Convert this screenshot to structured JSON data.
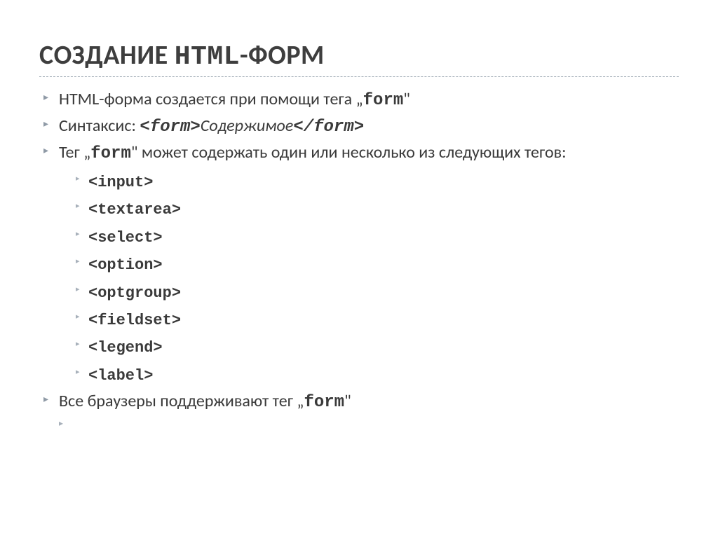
{
  "title": {
    "prefix": "СОЗДАНИЕ ",
    "mono": "HTML",
    "suffix": "-ФОРМ"
  },
  "bullets": [
    {
      "parts": [
        {
          "text": "HTML-форма создается при помощи тега  „"
        },
        {
          "text": "form",
          "cls": "mono-b"
        },
        {
          "text": "\""
        }
      ]
    },
    {
      "parts": [
        {
          "text": "Синтаксис: "
        },
        {
          "text": "<form>",
          "cls": "mono-bi"
        },
        {
          "text": "Содержимое",
          "cls": "ital"
        },
        {
          "text": "</form>",
          "cls": "mono-bi"
        }
      ]
    },
    {
      "parts": [
        {
          "text": "Тег  „"
        },
        {
          "text": "form",
          "cls": "mono-b"
        },
        {
          "text": "\"  может содержать один или несколько из следующих тегов:"
        }
      ],
      "sub": [
        "<input>",
        "<textarea>",
        "<select>",
        "<option>",
        "<optgroup>",
        "<fieldset>",
        "<legend>",
        "<label>"
      ]
    },
    {
      "parts": [
        {
          "text": "Все браузеры поддерживают тег  „"
        },
        {
          "text": "form",
          "cls": "mono-b"
        },
        {
          "text": "\""
        }
      ]
    }
  ]
}
